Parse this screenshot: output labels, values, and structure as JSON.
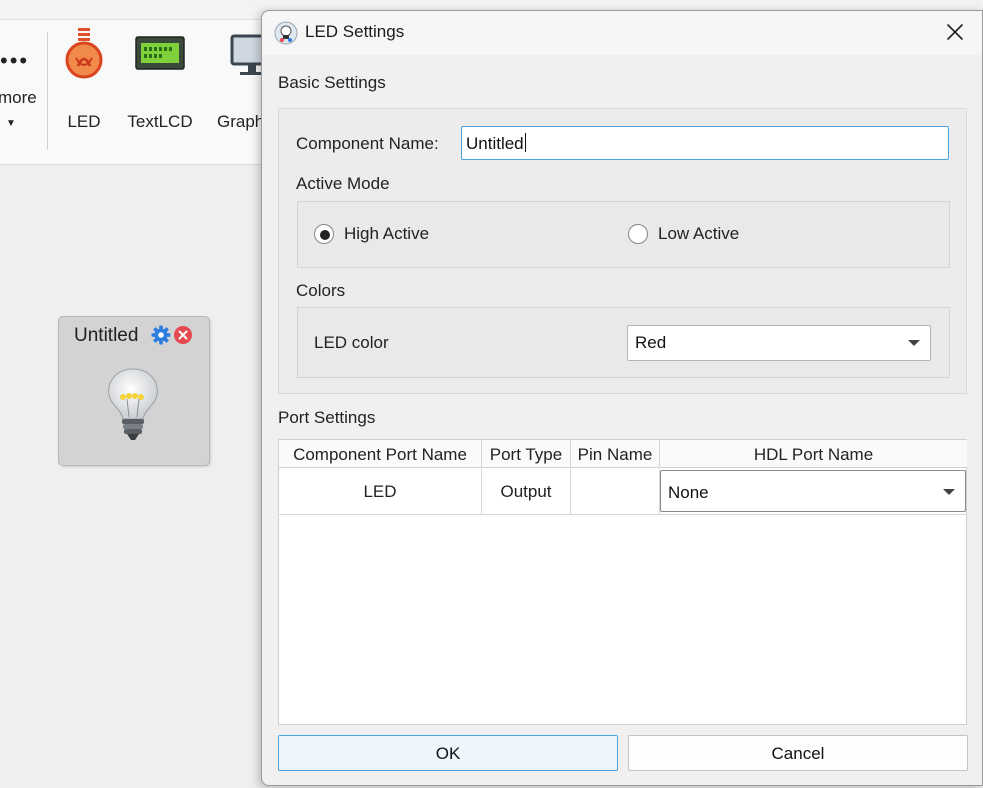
{
  "ribbon": {
    "more_label": "more",
    "buttons": [
      {
        "label": "LED",
        "icon": "led-bulb-icon"
      },
      {
        "label": "TextLCD",
        "icon": "textlcd-icon"
      },
      {
        "label": "Graph",
        "icon": "graph-monitor-icon"
      }
    ]
  },
  "canvas": {
    "led_component": {
      "title": "Untitled",
      "icon": "lightbulb-icon"
    }
  },
  "dialog": {
    "title": "LED Settings",
    "basic_settings": {
      "heading": "Basic Settings",
      "component_name_label": "Component Name:",
      "component_name_value": "Untitled",
      "active_mode": {
        "heading": "Active Mode",
        "options": [
          {
            "label": "High Active",
            "selected": true
          },
          {
            "label": "Low Active",
            "selected": false
          }
        ]
      },
      "colors": {
        "heading": "Colors",
        "led_color_label": "LED color",
        "led_color_value": "Red"
      }
    },
    "port_settings": {
      "heading": "Port Settings",
      "columns": [
        "Component Port Name",
        "Port Type",
        "Pin Name",
        "HDL Port Name"
      ],
      "rows": [
        {
          "component_port_name": "LED",
          "port_type": "Output",
          "pin_name": "",
          "hdl_port_name": "None"
        }
      ]
    },
    "buttons": {
      "ok": "OK",
      "cancel": "Cancel"
    },
    "colors": {
      "focus_border": "#4aa3df",
      "dialog_bg": "#f0f0f0"
    }
  }
}
